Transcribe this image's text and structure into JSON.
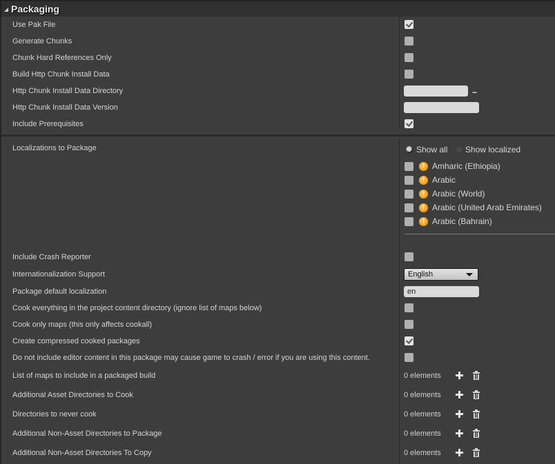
{
  "section": {
    "title": "Packaging",
    "collapse_icon": "triangle-down-icon"
  },
  "basic_settings": [
    {
      "label": "Use Pak File",
      "type": "checkbox",
      "checked": true
    },
    {
      "label": "Generate Chunks",
      "type": "checkbox",
      "checked": false
    },
    {
      "label": "Chunk Hard References Only",
      "type": "checkbox",
      "checked": false
    },
    {
      "label": "Build Http Chunk Install Data",
      "type": "checkbox",
      "checked": false
    },
    {
      "label": "Http Chunk Install Data Directory",
      "type": "path",
      "value": "",
      "browse_label": "..."
    },
    {
      "label": "Http Chunk Install Data Version",
      "type": "text",
      "value": ""
    },
    {
      "label": "Include Prerequisites",
      "type": "checkbox",
      "checked": true
    }
  ],
  "localizations": {
    "label": "Localizations to Package",
    "filter": {
      "show_all": "Show all",
      "show_localized": "Show localized",
      "selected": "Show all"
    },
    "items": [
      {
        "name": "Amharic (Ethiopia)",
        "checked": false,
        "icon": "warning-icon"
      },
      {
        "name": "Arabic",
        "checked": false,
        "icon": "warning-icon"
      },
      {
        "name": "Arabic (World)",
        "checked": false,
        "icon": "warning-icon"
      },
      {
        "name": "Arabic (United Arab Emirates)",
        "checked": false,
        "icon": "warning-icon"
      },
      {
        "name": "Arabic (Bahrain)",
        "checked": false,
        "icon": "warning-icon"
      }
    ]
  },
  "advanced_settings": [
    {
      "label": "Include Crash Reporter",
      "type": "checkbox",
      "checked": false
    },
    {
      "label": "Internationalization Support",
      "type": "dropdown",
      "value": "English"
    },
    {
      "label": "Package default localization",
      "type": "text",
      "value": "en"
    },
    {
      "label": "Cook everything in the project content directory (ignore list of maps below)",
      "type": "checkbox",
      "checked": false
    },
    {
      "label": "Cook only maps (this only affects cookall)",
      "type": "checkbox",
      "checked": false
    },
    {
      "label": "Create compressed cooked packages",
      "type": "checkbox",
      "checked": true
    },
    {
      "label": "Do not include editor content in this package may cause game to crash / error if you are using this content.",
      "type": "checkbox",
      "checked": false
    }
  ],
  "arrays": [
    {
      "label": "List of maps to include in a packaged build",
      "count_text": "0 elements"
    },
    {
      "label": "Additional Asset Directories to Cook",
      "count_text": "0 elements"
    },
    {
      "label": "Directories to never cook",
      "count_text": "0 elements"
    },
    {
      "label": "Additional Non-Asset Directories to Package",
      "count_text": "0 elements"
    },
    {
      "label": "Additional Non-Asset Directories To Copy",
      "count_text": "0 elements"
    }
  ]
}
